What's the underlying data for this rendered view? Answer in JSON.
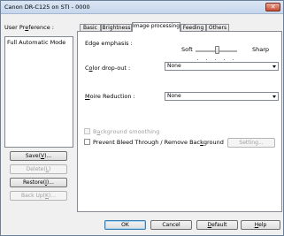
{
  "window": {
    "title": "Canon DR-C125 on STI - 0000",
    "close_glyph": "✕"
  },
  "user_preference": {
    "label_prefix": "User Pr",
    "label_mnemonic": "e",
    "label_suffix": "ference :",
    "items": [
      "Full Automatic Mode"
    ]
  },
  "side_buttons": {
    "save": {
      "prefix": "Save(",
      "mnemonic": "V",
      "suffix": ")..."
    },
    "delete": {
      "prefix": "Delete(",
      "mnemonic": "L",
      "suffix": ")"
    },
    "restore": {
      "prefix": "Restore(",
      "mnemonic": "I",
      "suffix": ")..."
    },
    "backup": {
      "prefix": "Back Up(",
      "mnemonic": "K",
      "suffix": ")..."
    }
  },
  "tabs": [
    {
      "label": "Basic"
    },
    {
      "label": "Brightness"
    },
    {
      "label": "Image processing"
    },
    {
      "label": "Feeding"
    },
    {
      "label": "Others"
    }
  ],
  "image_processing": {
    "edge_emphasis": {
      "label": "Edge emphasis :",
      "min_label": "Soft",
      "max_label": "Sharp",
      "level": 0.45
    },
    "color_dropout": {
      "label_prefix": "C",
      "label_mnemonic": "o",
      "label_suffix": "lor drop-out :",
      "value": "None"
    },
    "moire_reduction": {
      "label_prefix": "",
      "label_mnemonic": "M",
      "label_suffix": "oire Reduction :",
      "value": "None"
    },
    "background_smoothing": {
      "label_prefix": "B",
      "label_mnemonic": "a",
      "label_suffix": "ckground smoothing",
      "checked": false,
      "enabled": false
    },
    "prevent_bleed": {
      "label_prefix": "Prevent Bleed Through / Remove Bac",
      "label_mnemonic": "k",
      "label_suffix": "ground",
      "checked": false
    },
    "setting_button": "Setting..."
  },
  "footer_buttons": {
    "ok": "OK",
    "cancel": "Cancel",
    "default": {
      "prefix": "",
      "mnemonic": "D",
      "suffix": "efault"
    },
    "help": {
      "prefix": "",
      "mnemonic": "H",
      "suffix": "elp"
    }
  }
}
